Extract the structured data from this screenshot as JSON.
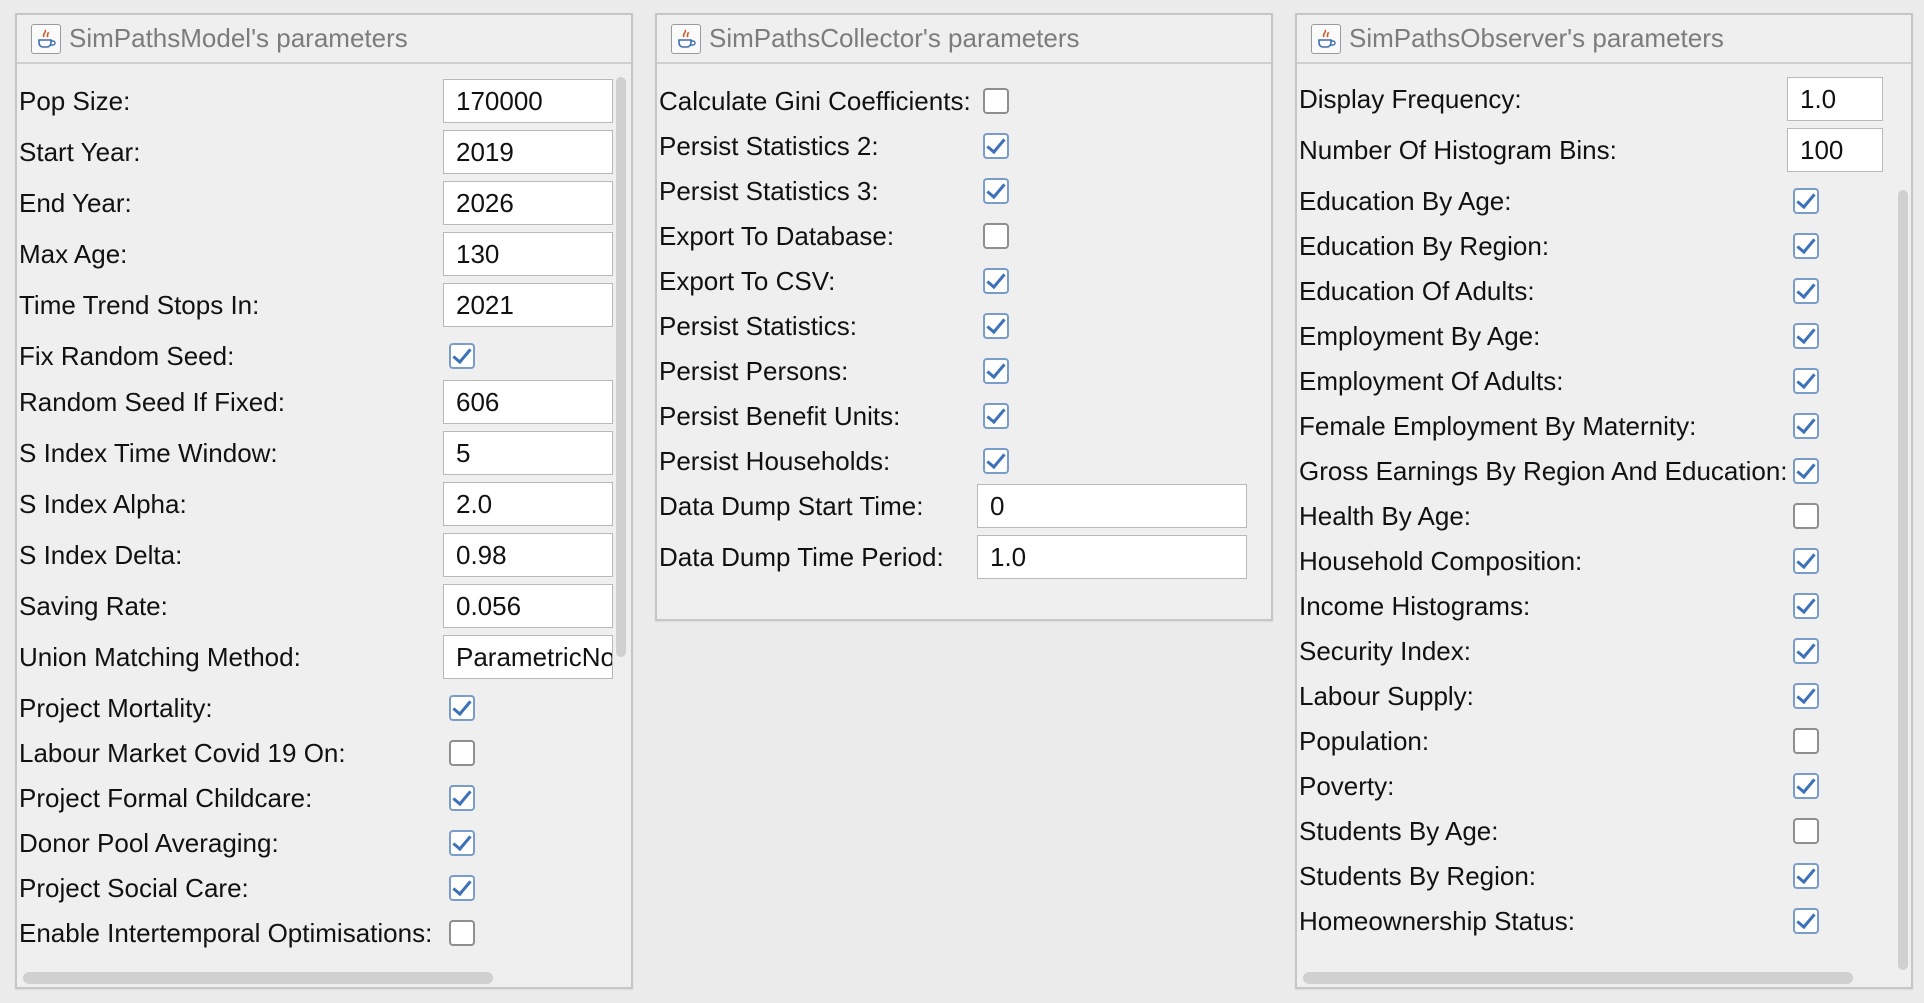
{
  "model": {
    "title": "SimPathsModel's parameters",
    "fields": [
      {
        "label": "Pop Size:",
        "type": "text",
        "value": "170000"
      },
      {
        "label": "Start Year:",
        "type": "text",
        "value": "2019"
      },
      {
        "label": "End Year:",
        "type": "text",
        "value": "2026"
      },
      {
        "label": "Max Age:",
        "type": "text",
        "value": "130"
      },
      {
        "label": "Time Trend Stops In:",
        "type": "text",
        "value": "2021"
      },
      {
        "label": "Fix Random Seed:",
        "type": "check",
        "checked": true
      },
      {
        "label": "Random Seed If Fixed:",
        "type": "text",
        "value": "606"
      },
      {
        "label": "S Index Time Window:",
        "type": "text",
        "value": "5"
      },
      {
        "label": "S Index Alpha:",
        "type": "text",
        "value": "2.0"
      },
      {
        "label": "S Index Delta:",
        "type": "text",
        "value": "0.98"
      },
      {
        "label": "Saving Rate:",
        "type": "text",
        "value": "0.056"
      },
      {
        "label": "Union Matching Method:",
        "type": "text",
        "value": "ParametricNo"
      },
      {
        "label": "Project Mortality:",
        "type": "check",
        "checked": true
      },
      {
        "label": "Labour Market Covid 19 On:",
        "type": "check",
        "checked": false
      },
      {
        "label": "Project Formal Childcare:",
        "type": "check",
        "checked": true
      },
      {
        "label": "Donor Pool Averaging:",
        "type": "check",
        "checked": true
      },
      {
        "label": "Project Social Care:",
        "type": "check",
        "checked": true
      },
      {
        "label": "Enable Intertemporal Optimisations:",
        "type": "check",
        "checked": false
      }
    ]
  },
  "collector": {
    "title": "SimPathsCollector's parameters",
    "fields": [
      {
        "label": "Calculate Gini Coefficients:",
        "type": "check",
        "checked": false
      },
      {
        "label": "Persist Statistics 2:",
        "type": "check",
        "checked": true
      },
      {
        "label": "Persist Statistics 3:",
        "type": "check",
        "checked": true
      },
      {
        "label": "Export To Database:",
        "type": "check",
        "checked": false
      },
      {
        "label": "Export To CSV:",
        "type": "check",
        "checked": true
      },
      {
        "label": "Persist Statistics:",
        "type": "check",
        "checked": true
      },
      {
        "label": "Persist Persons:",
        "type": "check",
        "checked": true
      },
      {
        "label": "Persist Benefit Units:",
        "type": "check",
        "checked": true
      },
      {
        "label": "Persist Households:",
        "type": "check",
        "checked": true
      },
      {
        "label": "Data Dump Start Time:",
        "type": "text",
        "value": "0"
      },
      {
        "label": "Data Dump Time Period:",
        "type": "text",
        "value": "1.0"
      }
    ]
  },
  "observer": {
    "title": "SimPathsObserver's parameters",
    "fields": [
      {
        "label": "Display Frequency:",
        "type": "text",
        "value": "1.0"
      },
      {
        "label": "Number Of Histogram Bins:",
        "type": "text",
        "value": "100"
      },
      {
        "label": "Education By Age:",
        "type": "check",
        "checked": true
      },
      {
        "label": "Education By Region:",
        "type": "check",
        "checked": true
      },
      {
        "label": "Education Of Adults:",
        "type": "check",
        "checked": true
      },
      {
        "label": "Employment By Age:",
        "type": "check",
        "checked": true
      },
      {
        "label": "Employment Of Adults:",
        "type": "check",
        "checked": true
      },
      {
        "label": "Female Employment By Maternity:",
        "type": "check",
        "checked": true
      },
      {
        "label": "Gross Earnings By Region And Education:",
        "type": "check",
        "checked": true
      },
      {
        "label": "Health By Age:",
        "type": "check",
        "checked": false
      },
      {
        "label": "Household Composition:",
        "type": "check",
        "checked": true
      },
      {
        "label": "Income Histograms:",
        "type": "check",
        "checked": true
      },
      {
        "label": "Security Index:",
        "type": "check",
        "checked": true
      },
      {
        "label": "Labour Supply:",
        "type": "check",
        "checked": true
      },
      {
        "label": "Population:",
        "type": "check",
        "checked": false
      },
      {
        "label": "Poverty:",
        "type": "check",
        "checked": true
      },
      {
        "label": "Students By Age:",
        "type": "check",
        "checked": false
      },
      {
        "label": "Students By Region:",
        "type": "check",
        "checked": true
      },
      {
        "label": "Homeownership Status:",
        "type": "check",
        "checked": true
      }
    ]
  }
}
